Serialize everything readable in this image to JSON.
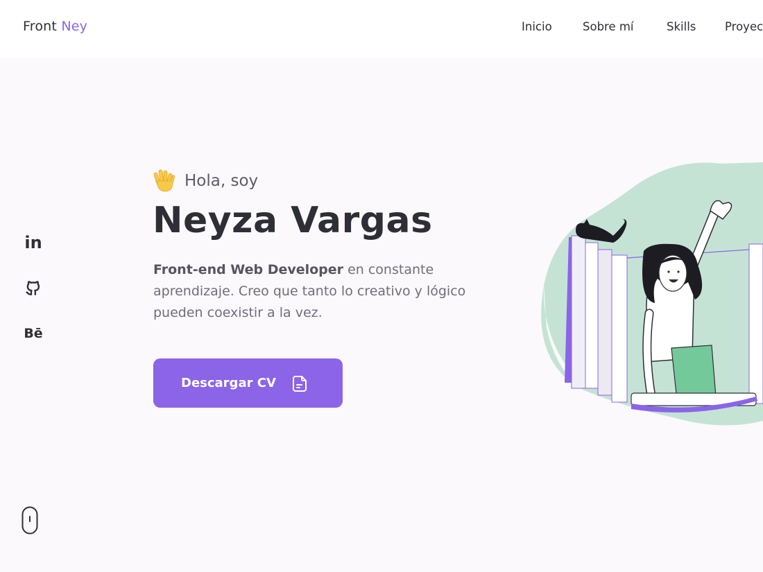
{
  "header": {
    "logo_main": "Front",
    "logo_accent": "Ney",
    "nav": [
      "Inicio",
      "Sobre mí",
      "Skills",
      "Proyectos"
    ]
  },
  "social": {
    "icons": [
      "linkedin-icon",
      "github-icon",
      "behance-icon"
    ],
    "linkedin_text": "in",
    "behance_text": "Bē"
  },
  "hero": {
    "greeting": "Hola, soy",
    "name": "Neyza Vargas",
    "description_bold": "Front-end Web Developer",
    "description_rest": " en constante aprendizaje. Creo que tanto lo creativo y lógico pueden coexistir a la vez.",
    "button_label": "Descargar CV"
  },
  "colors": {
    "accent": "#8b64e8",
    "text": "#2e2e36",
    "blob": "#c5e3d5",
    "pants": "#74c99a"
  }
}
